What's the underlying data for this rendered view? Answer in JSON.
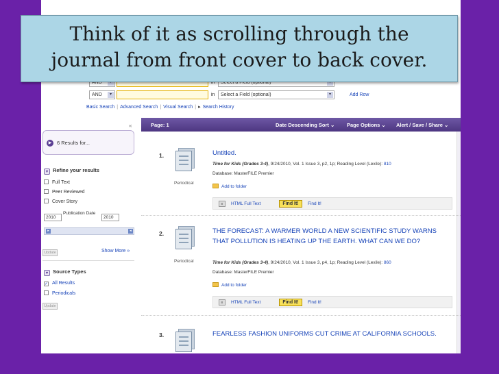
{
  "caption": {
    "line1": "Think of it as scrolling through the",
    "line2": "journal from front cover to back cover."
  },
  "search": {
    "bool_op": "AND",
    "in_label": "in",
    "field_placeholder": "Select a Field (optional)",
    "add_row": "Add Row",
    "nav": [
      "Basic Search",
      "Advanced Search",
      "Visual Search",
      "Search History"
    ],
    "nav_sep": "|",
    "history_arrow": "▸"
  },
  "left": {
    "collapse": "«",
    "results_for": "6 Results for...",
    "refine_title": "Refine your results",
    "refine_options": [
      "Full Text",
      "Peer Reviewed",
      "Cover Story"
    ],
    "pub_date_label": "Publication Date",
    "date_from": "2010",
    "date_to": "2010",
    "update_label": "Update",
    "show_more": "Show More »",
    "source_title": "Source Types",
    "source_options": [
      "All Results",
      "Periodicals"
    ]
  },
  "results_bar": {
    "page": "Page: 1",
    "sort": "Date Descending Sort ⌄",
    "page_options": "Page Options ⌄",
    "share": "Alert / Save / Share ⌄"
  },
  "results": [
    {
      "num": "1.",
      "type": "Periodical",
      "title": "Untitled.",
      "journal": "Time for Kids (Grades 3-4)",
      "details": ", 9/24/2010, Vol. 1 Issue 3, p2, 1p; Reading Level (Lexile): ",
      "lexile": "810",
      "database": "Database: MasterFILE Premier",
      "folder": "Add to folder",
      "html": "HTML Full Text",
      "findit_btn": "Find It!",
      "findit_link": "Find It!"
    },
    {
      "num": "2.",
      "type": "Periodical",
      "title": "THE FORECAST: A WARMER WORLD A NEW SCIENTIFIC STUDY WARNS THAT POLLUTION IS HEATING UP THE EARTH. WHAT CAN WE DO?",
      "journal": "Time for Kids (Grades 3-4)",
      "details": ", 9/24/2010, Vol. 1 Issue 3, p4, 1p; Reading Level (Lexile): ",
      "lexile": "860",
      "database": "Database: MasterFILE Premier",
      "folder": "Add to folder",
      "html": "HTML Full Text",
      "findit_btn": "Find It!",
      "findit_link": "Find It!"
    },
    {
      "num": "3.",
      "title": "FEARLESS FASHION UNIFORMS CUT CRIME AT CALIFORNIA SCHOOLS."
    }
  ]
}
